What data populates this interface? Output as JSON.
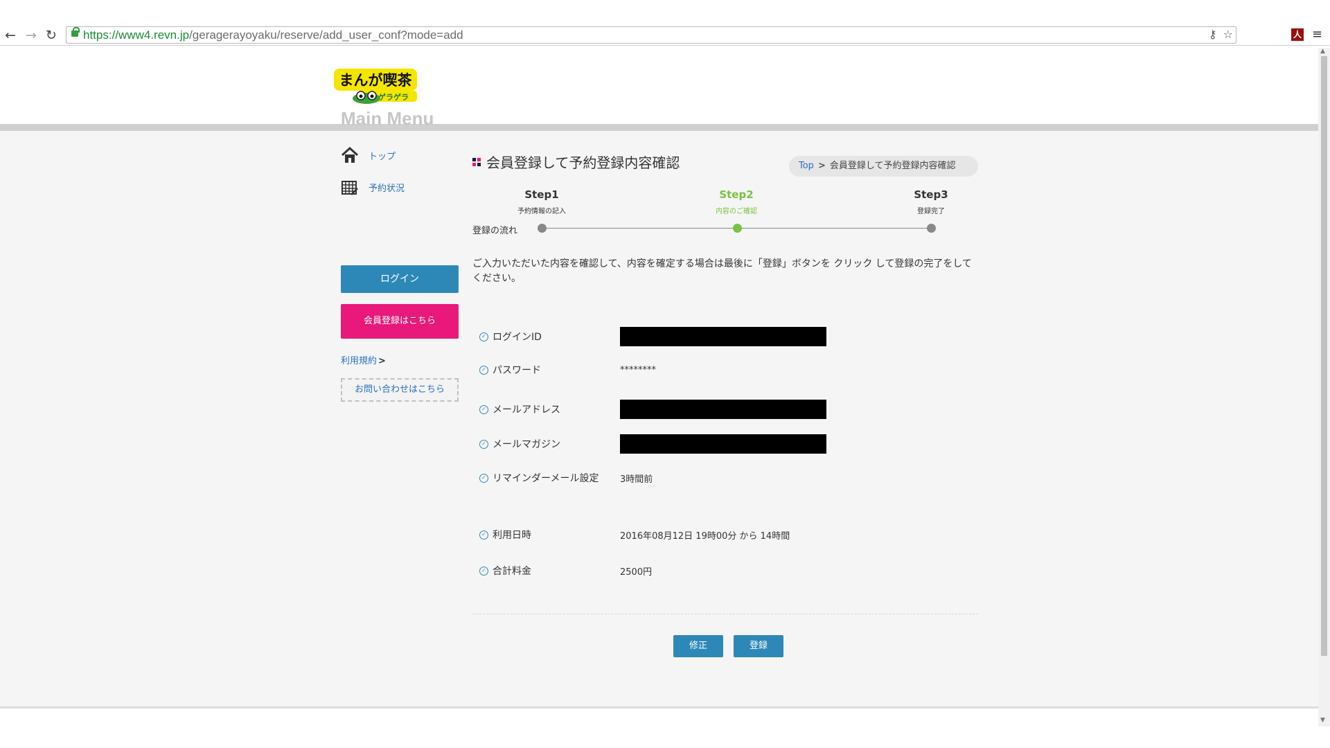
{
  "browser": {
    "url_scheme": "https://",
    "url_host": "www4.revn.jp",
    "url_path": "/geragerayoyaku/reserve/add_user_conf?mode=add",
    "pdf_label": "人"
  },
  "logo": {
    "text_top": "まんが喫茶",
    "text_bottom": "ゲラゲラ"
  },
  "sidebar": {
    "title": "Main Menu",
    "items": [
      {
        "label": "トップ",
        "icon": "home-icon"
      },
      {
        "label": "予約状況",
        "icon": "calendar-icon"
      }
    ],
    "login_label": "ログイン",
    "register_label": "会員登録はこちら",
    "terms_label": "利用規約",
    "contact_label": "お問い合わせはこちら"
  },
  "main": {
    "title": "会員登録して予約登録内容確認",
    "breadcrumb": {
      "top": "Top",
      "current": "会員登録して予約登録内容確認"
    },
    "flow_label": "登録の流れ",
    "steps": [
      {
        "name": "Step1",
        "desc": "予約情報の記入",
        "active": false
      },
      {
        "name": "Step2",
        "desc": "内容のご確認",
        "active": true
      },
      {
        "name": "Step3",
        "desc": "登録完了",
        "active": false
      }
    ],
    "intro": "ご入力いただいた内容を確認して、内容を確定する場合は最後に「登録」ボタンを クリック して登録の完了をしてください。",
    "fields": [
      {
        "label": "ログインID",
        "value": "",
        "redacted": true
      },
      {
        "label": "パスワード",
        "value": "********",
        "redacted": false
      },
      {
        "label": "メールアドレス",
        "value": "",
        "redacted": true
      },
      {
        "label": "メールマガジン",
        "value": "",
        "redacted": true
      },
      {
        "label": "リマインダーメール設定",
        "value": "3時間前",
        "redacted": false
      },
      {
        "label": "利用日時",
        "value": "2016年08月12日 19時00分 から 14時間",
        "redacted": false
      },
      {
        "label": "合計料金",
        "value": "2500円",
        "redacted": false
      }
    ],
    "edit_label": "修正",
    "submit_label": "登録"
  },
  "colors": {
    "accent_blue": "#2d88b8",
    "accent_pink": "#e8197a",
    "step_active": "#7ac143"
  }
}
